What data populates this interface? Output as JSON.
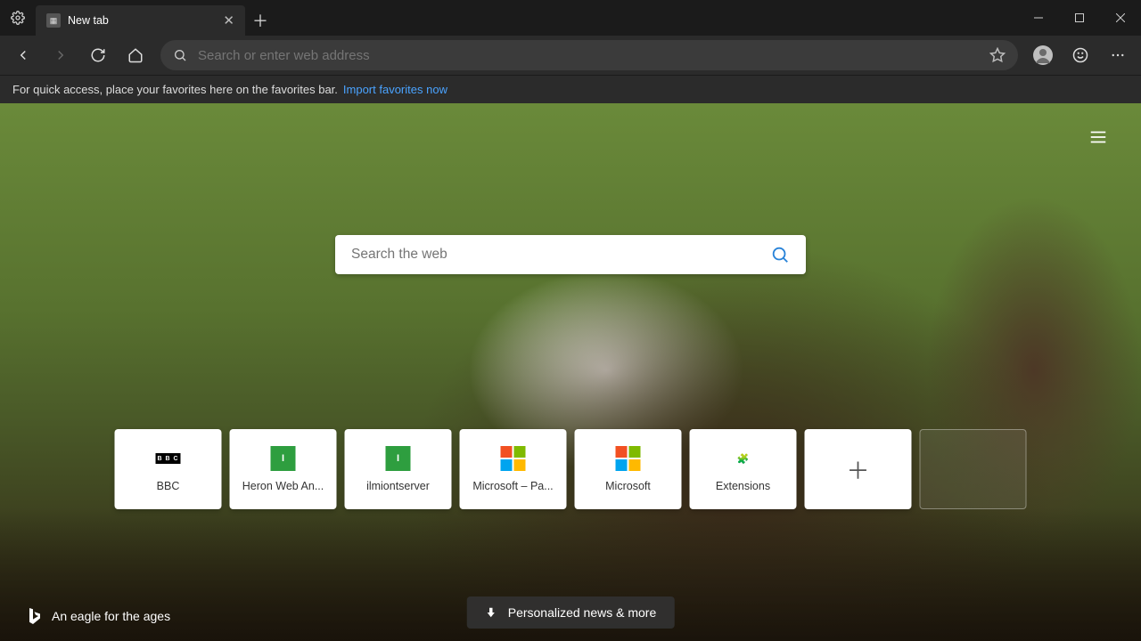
{
  "window": {
    "tab_title": "New tab"
  },
  "toolbar": {
    "address_placeholder": "Search or enter web address"
  },
  "favbar": {
    "text": "For quick access, place your favorites here on the favorites bar.",
    "link": "Import favorites now"
  },
  "newtab": {
    "search_placeholder": "Search the web",
    "tiles": [
      {
        "label": "BBC",
        "icon": "bbc"
      },
      {
        "label": "Heron Web An...",
        "icon": "green"
      },
      {
        "label": "ilmiontserver",
        "icon": "green"
      },
      {
        "label": "Microsoft – Pa...",
        "icon": "mslogo"
      },
      {
        "label": "Microsoft",
        "icon": "mslogo"
      },
      {
        "label": "Extensions",
        "icon": "ext"
      }
    ],
    "caption": "An eagle for the ages",
    "news_button": "Personalized news & more"
  }
}
